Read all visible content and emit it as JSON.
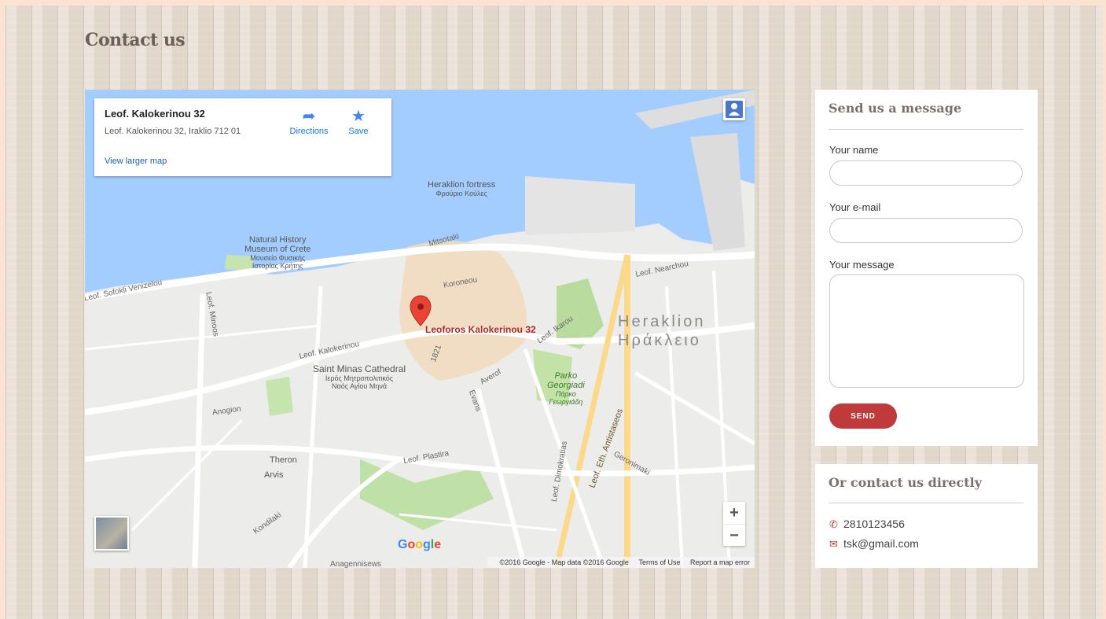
{
  "page": {
    "title": "Contact us"
  },
  "map": {
    "info_card": {
      "title": "Leof. Kalokerinou 32",
      "address": "Leof. Kalokerinou 32, Iraklio 712 01",
      "directions_label": "Directions",
      "save_label": "Save",
      "view_larger_label": "View larger map"
    },
    "marker_label": "Leoforos Kalokerinou 32",
    "places": {
      "fortress": "Heraklion fortress",
      "fortress_gr": "Φρούριο Κούλες",
      "museum_1": "Natural History",
      "museum_2": "Museum of Crete",
      "museum_3": "Μουσείο Φυσικής",
      "museum_4": "Ιστορίας Κρήτης",
      "cathedral_1": "Saint Minas Cathedral",
      "cathedral_2": "Ιερός Μητροπολιτικός",
      "cathedral_3": "Ναός Αγίου Μηνά",
      "park_1": "Parko",
      "park_2": "Georgiadi",
      "park_3": "Πάρκο",
      "park_4": "Γεωργιάδη",
      "city_en": "Heraklion",
      "city_gr": "Ηράκλειο",
      "theron": "Theron",
      "arvis": "Arvis"
    },
    "roads": {
      "r1": "Leof. Sofokli Venizelou",
      "r2": "Mitsotaki",
      "r3": "Leof. Nearchou",
      "r4": "Leof. Kalokerinou",
      "r5": "Leof. Ikarou",
      "r6": "Leof. Plastira",
      "r7": "Leof. Eth. Antistaseos",
      "r8": "Anogion",
      "r9": "Evans",
      "r10": "Averof",
      "r11": "Koroneou",
      "r12": "Leof. Minoos",
      "r13": "1821",
      "r14": "Kondilaki",
      "r15": "Leof. Dimokratias",
      "r16": "Geronimaki",
      "r17": "Anagennisews"
    },
    "zoom_in": "+",
    "zoom_out": "−",
    "google_logo": [
      "G",
      "o",
      "o",
      "g",
      "l",
      "e"
    ],
    "google_colors": [
      "#4285f4",
      "#ea4335",
      "#fbbc05",
      "#4285f4",
      "#34a853",
      "#ea4335"
    ],
    "attribution": {
      "copyright": "©2016 Google - Map data ©2016 Google",
      "terms": "Terms of Use",
      "report": "Report a map error"
    }
  },
  "form": {
    "title": "Send us a message",
    "name_label": "Your name",
    "email_label": "Your e-mail",
    "message_label": "Your message",
    "send_label": "SEND"
  },
  "contact": {
    "title": "Or contact us directly",
    "phone": "2810123456",
    "email": "tsk@gmail.com",
    "accent_color": "#c0393b"
  },
  "icons": {
    "directions": "directions-icon",
    "save": "star-icon",
    "phone": "phone-icon",
    "email": "envelope-icon"
  }
}
